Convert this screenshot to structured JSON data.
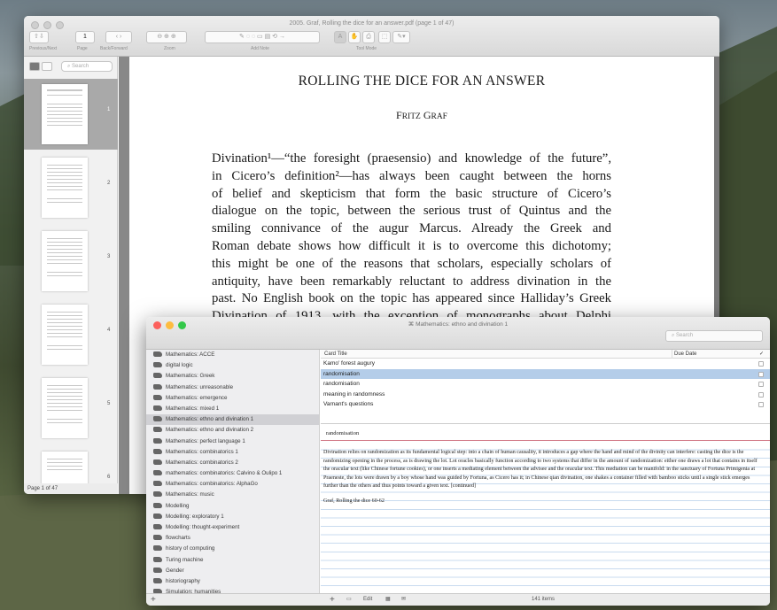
{
  "preview": {
    "title": "2005. Graf, Rolling the dice for an answer.pdf (page 1 of 47)",
    "toolbar": {
      "page_value": "1",
      "labels": [
        "Previous/Next",
        "Page",
        "Back/Forward",
        "Zoom",
        "Add Note",
        "Tool Mode"
      ]
    },
    "sidebar": {
      "search_placeholder": "Search",
      "thumb_numbers": [
        "1",
        "2",
        "3",
        "4",
        "5",
        "6"
      ],
      "status": "Page 1 of 47"
    },
    "page": {
      "title": "ROLLING THE DICE FOR AN ANSWER",
      "author_first": "F",
      "author_rest": "RITZ",
      "author_first2": "G",
      "author_rest2": "RAF",
      "lines": [
        "Divination¹—“the foresight (praesensio) and knowledge of the future”,",
        "in Cicero’s definition²—has always been caught between the horns",
        "of belief and skepticism that form the basic structure of Cicero’s",
        "dialogue on the topic, between the serious trust of Quintus and the",
        "smiling connivance of the augur Marcus. Already the Greek and",
        "Roman debate shows how difficult it is to overcome this dichotomy;",
        "this might be one of the reasons that scholars, especially scholars of",
        "antiquity, have been remarkably reluctant to address divination in the",
        "past. No English book on the topic has appeared since Halliday’s Greek",
        "Divination of 1913, with the exception of monographs about Delphi"
      ]
    }
  },
  "flashcards": {
    "title": "Mathematics: ethno and divination 1",
    "search_placeholder": "Search",
    "decks": [
      "Mathematics: ACCE",
      "digital logic",
      "Mathematics: Greek",
      "Mathematics: unreasonable",
      "Mathematics: emergence",
      "Mathematics: mixed 1",
      "Mathematics: ethno and divination 1",
      "Mathematics: ethno and divination 2",
      "Mathematics: perfect language 1",
      "Mathematics: combinatorics 1",
      "Mathematics: combinatorics 2",
      "mathematics: combinatorics: Calvino & Oulipo 1",
      "Mathematics: combinatorics: AlphaGo",
      "Mathematics: music",
      "Modelling",
      "Modelling: exploratory 1",
      "Modelling: thought-experiment",
      "flowcharts",
      "history of computing",
      "Turing machine",
      "Gender",
      "historiography",
      "Simulation: humanities"
    ],
    "selected_deck": "Mathematics: ethno and divination 1",
    "columns": {
      "title": "Card Title",
      "due": "Due Date",
      "check": "✓"
    },
    "cards": [
      "Kamo' forest augury",
      "randomisation",
      "randomisation",
      "meaning in randomness",
      "Varnant's questions"
    ],
    "front": "randomisation",
    "back": "Divination relies on randomization as its fundamental logical step: into a chain of human causality, it introduces a gap where the hand and mind of the divinity can interfere: casting the dice is the randomizing opening in the process, as is drawing the lot. Lot oracles basically function according to two systems that differ in the amount of randomization: either one draws a lot that contains in itself the oracular text (like Chinese fortune cookies), or one inserts a mediating element between the advisee and the oracular text. This mediation can be manifold: in the sanctuary of Fortuna Primigenia at Praeneste, the lots were drawn by a boy whose hand was guided by Fortuna, as Cicero has it; in Chinese qian divination, one shakes a container filled with bamboo sticks until a single stick emerges further than the others and thus points toward a given text. [continued]",
    "source": "Graf, Rolling the dice 60-62",
    "bottom": {
      "add": "+",
      "edit": "Edit",
      "count": "141 items"
    }
  }
}
